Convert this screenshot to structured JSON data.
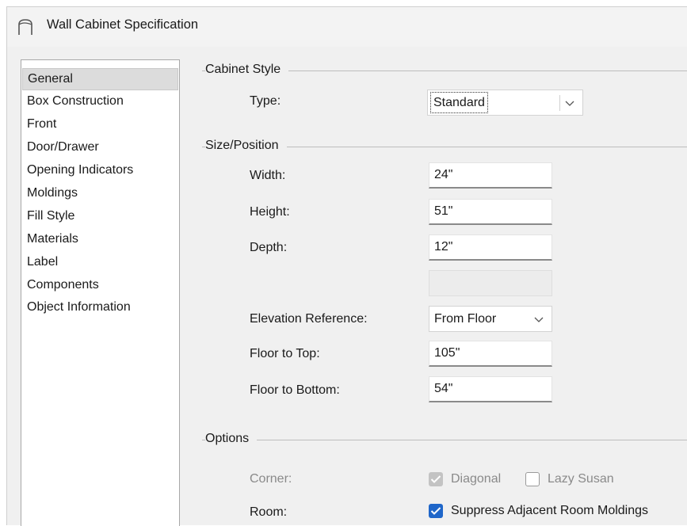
{
  "window": {
    "title": "Wall Cabinet Specification"
  },
  "sidebar": {
    "items": [
      {
        "label": "General",
        "selected": true
      },
      {
        "label": "Box Construction"
      },
      {
        "label": "Front"
      },
      {
        "label": "Door/Drawer"
      },
      {
        "label": "Opening Indicators"
      },
      {
        "label": "Moldings"
      },
      {
        "label": "Fill Style"
      },
      {
        "label": "Materials"
      },
      {
        "label": "Label"
      },
      {
        "label": "Components"
      },
      {
        "label": "Object Information"
      }
    ]
  },
  "cabinet_style": {
    "group_label": "Cabinet Style",
    "type_label": "Type:",
    "type_value": "Standard"
  },
  "size_position": {
    "group_label": "Size/Position",
    "width_label": "Width:",
    "width_value": "24\"",
    "height_label": "Height:",
    "height_value": "51\"",
    "depth_label": "Depth:",
    "depth_value": "12\"",
    "elevation_label": "Elevation Reference:",
    "elevation_value": "From Floor",
    "floor_top_label": "Floor to Top:",
    "floor_top_value": "105\"",
    "floor_bottom_label": "Floor to Bottom:",
    "floor_bottom_value": "54\""
  },
  "options": {
    "group_label": "Options",
    "corner_label": "Corner:",
    "diagonal_label": "Diagonal",
    "diagonal_checked": true,
    "lazy_susan_label": "Lazy Susan",
    "lazy_susan_checked": false,
    "room_label": "Room:",
    "suppress_label": "Suppress Adjacent Room Moldings",
    "suppress_checked": true
  },
  "colors": {
    "accent": "#1f66c9",
    "selection": "#dcdcdc",
    "dialog_bg": "#f0f0f0"
  }
}
